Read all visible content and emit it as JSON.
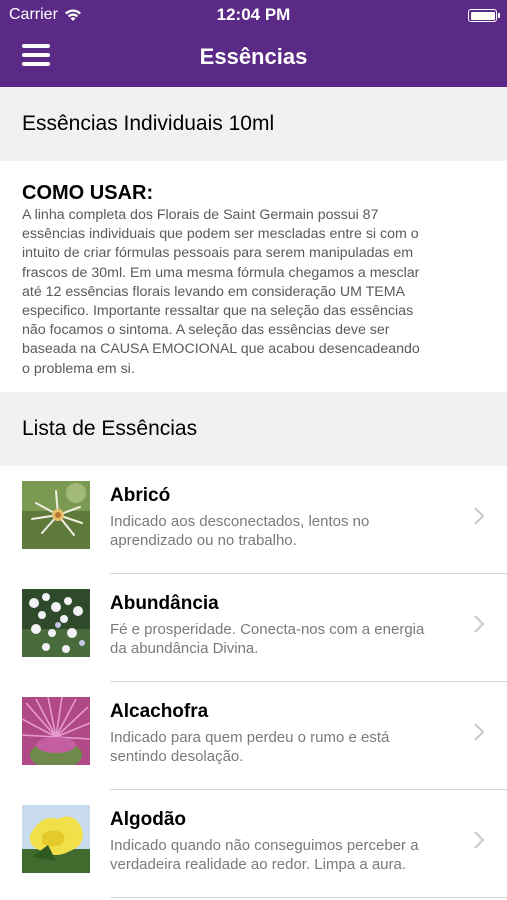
{
  "status_bar": {
    "carrier": "Carrier",
    "time": "12:04 PM"
  },
  "nav": {
    "title": "Essências",
    "menu_icon": "hamburger-menu-icon"
  },
  "product_header": "Essências Individuais 10ml",
  "how_to": {
    "title": "COMO USAR:",
    "lines": [
      "A linha completa dos Florais de Saint Germain possui 87",
      "essências individuais que podem ser mescladas entre si com o",
      "intuito de criar fórmulas pessoais para serem manipuladas em",
      "frascos de 30ml. Em uma mesma fórmula chegamos a mesclar",
      "até 12 essências florais levando em consideração UM TEMA",
      "especifico. Importante ressaltar que na seleção das essências",
      "não focamos o sintoma. A seleção das essências deve ser",
      "baseada na CAUSA EMOCIONAL que acabou desencadeando",
      "o problema em si."
    ]
  },
  "list_header": "Lista de Essências",
  "essences": [
    {
      "name": "Abricó",
      "desc_lines": [
        "Indicado aos desconectados, lentos no",
        "aprendizado ou no trabalho."
      ]
    },
    {
      "name": "Abundância",
      "desc_lines": [
        "Fé e prosperidade. Conecta-nos com a energia",
        "da abundância Divina."
      ]
    },
    {
      "name": "Alcachofra",
      "desc_lines": [
        "Indicado para quem perdeu o rumo e está",
        "sentindo desolação."
      ]
    },
    {
      "name": "Algodão",
      "desc_lines": [
        "Indicado quando não conseguimos perceber a",
        "verdadeira realidade ao redor. Limpa a aura."
      ]
    }
  ],
  "colors": {
    "nav_bg": "#5b2a86",
    "section_bg": "#f1f1f1",
    "desc_text": "#7a7a7a"
  }
}
